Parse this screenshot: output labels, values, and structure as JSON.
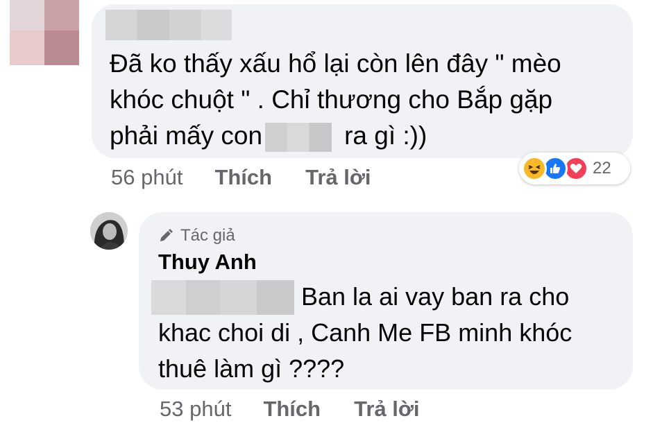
{
  "comment1": {
    "text_lines": [
      "Đã ko thấy xấu hổ lại còn lên đây \" mèo",
      "khóc chuột \" . Chỉ thương cho Bắp gặp",
      "phải mấy con",
      "ra gì :))"
    ],
    "time": "56 phút",
    "like_label": "Thích",
    "reply_label": "Trả lời",
    "reactions": {
      "icons": [
        "haha-icon",
        "like-icon",
        "love-icon"
      ],
      "count": "22"
    }
  },
  "reply": {
    "badge_label": "Tác giả",
    "author_name": "Thuy Anh",
    "text_lines": [
      "Ban la ai vay ban ra cho",
      "khac choi di , Canh Me FB minh khóc",
      "thuê làm gì ????"
    ],
    "time": "53 phút",
    "like_label": "Thích",
    "reply_label": "Trả lời"
  },
  "colors": {
    "bubble": "#f0f2f5",
    "text": "#050505",
    "secondary": "#65676b",
    "like_blue": "#1877f2",
    "love_red": "#f33e58",
    "haha_yellow": "#f7b928"
  }
}
